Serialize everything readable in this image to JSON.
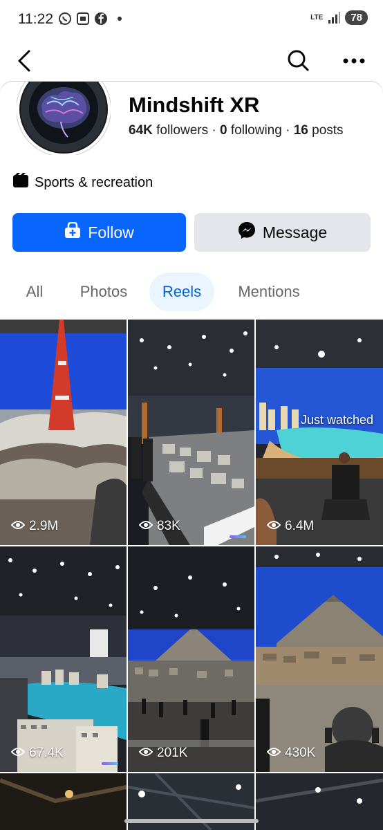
{
  "status_bar": {
    "time": "11:22",
    "network": "LTE",
    "battery": "78"
  },
  "profile": {
    "name": "Mindshift XR",
    "followers_count": "64K",
    "followers_label": "followers",
    "following_count": "0",
    "following_label": "following",
    "posts_count": "16",
    "posts_label": "posts",
    "separator": "·",
    "category": "Sports & recreation"
  },
  "actions": {
    "follow_label": "Follow",
    "message_label": "Message"
  },
  "tabs": [
    {
      "label": "All",
      "active": false
    },
    {
      "label": "Photos",
      "active": false
    },
    {
      "label": "Reels",
      "active": true
    },
    {
      "label": "Mentions",
      "active": false
    }
  ],
  "reels": [
    {
      "views": "2.9M"
    },
    {
      "views": "83K"
    },
    {
      "views": "6.4M",
      "badge": "Just watched"
    },
    {
      "views": "67.4K"
    },
    {
      "views": "201K"
    },
    {
      "views": "430K"
    }
  ],
  "colors": {
    "accent": "#0866ff",
    "active_tab_bg": "#ebf5ff",
    "active_tab_text": "#0064d1"
  },
  "icons": [
    "back-arrow-icon",
    "search-icon",
    "more-icon",
    "category-icon",
    "follow-icon",
    "messenger-icon",
    "eye-icon"
  ]
}
